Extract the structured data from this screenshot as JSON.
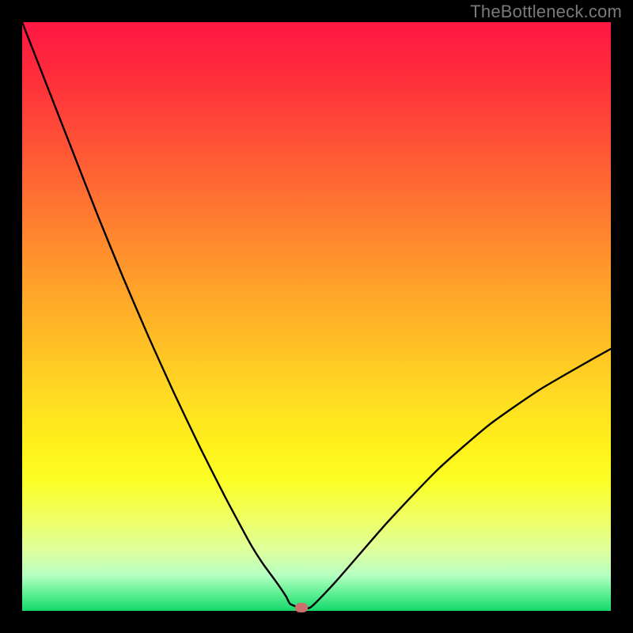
{
  "watermark": "TheBottleneck.com",
  "colors": {
    "background": "#000000",
    "curve_stroke": "#000000",
    "marker_fill": "#cc6f6f"
  },
  "chart_data": {
    "type": "line",
    "title": "",
    "xlabel": "",
    "ylabel": "",
    "xlim": [
      0,
      100
    ],
    "ylim": [
      0,
      100
    ],
    "curve": {
      "x": [
        0.0,
        4.3,
        8.6,
        12.9,
        17.2,
        21.5,
        25.8,
        30.1,
        34.4,
        38.7,
        40.9,
        43.1,
        44.8,
        45.5,
        47.0,
        49.0,
        53.3,
        62.0,
        70.6,
        79.2,
        87.8,
        96.4,
        100.0
      ],
      "y": [
        100.0,
        89.0,
        78.0,
        67.0,
        56.5,
        46.5,
        37.0,
        28.0,
        19.5,
        11.5,
        8.0,
        5.0,
        2.5,
        1.2,
        0.6,
        0.6,
        5.0,
        15.0,
        24.0,
        31.5,
        37.5,
        42.5,
        44.5
      ]
    },
    "marker": {
      "x": 47.5,
      "y": 0.6
    }
  }
}
